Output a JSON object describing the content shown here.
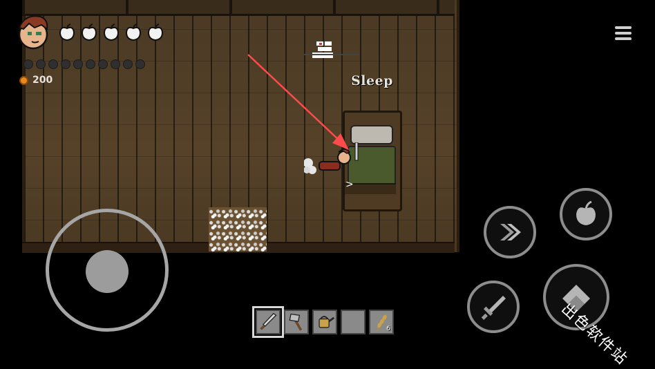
{
  "hud": {
    "health_icon": "apple-icon",
    "health_count": 5,
    "hunger_slots": 10,
    "coins": "200",
    "coin_color": "#e98a1c"
  },
  "world": {
    "interaction_label": "Sleep",
    "prompt_glyph": ">"
  },
  "controls": {
    "menu_icon": "hamburger-icon",
    "dash_icon": "double-chevron-icon",
    "eat_icon": "apple-icon",
    "attack_icon": "sword-icon",
    "interact_icon": "hand-icon"
  },
  "hotbar": {
    "slots": [
      {
        "item": "sword-icon",
        "count": ""
      },
      {
        "item": "axe-icon",
        "count": ""
      },
      {
        "item": "watering-can-icon",
        "count": ""
      },
      {
        "item": "",
        "count": ""
      },
      {
        "item": "wheat-icon",
        "count": "6"
      }
    ],
    "selected_index": 0
  },
  "overlay": {
    "annotation_color": "#ff4b4b",
    "watermark": "出色软件站"
  }
}
